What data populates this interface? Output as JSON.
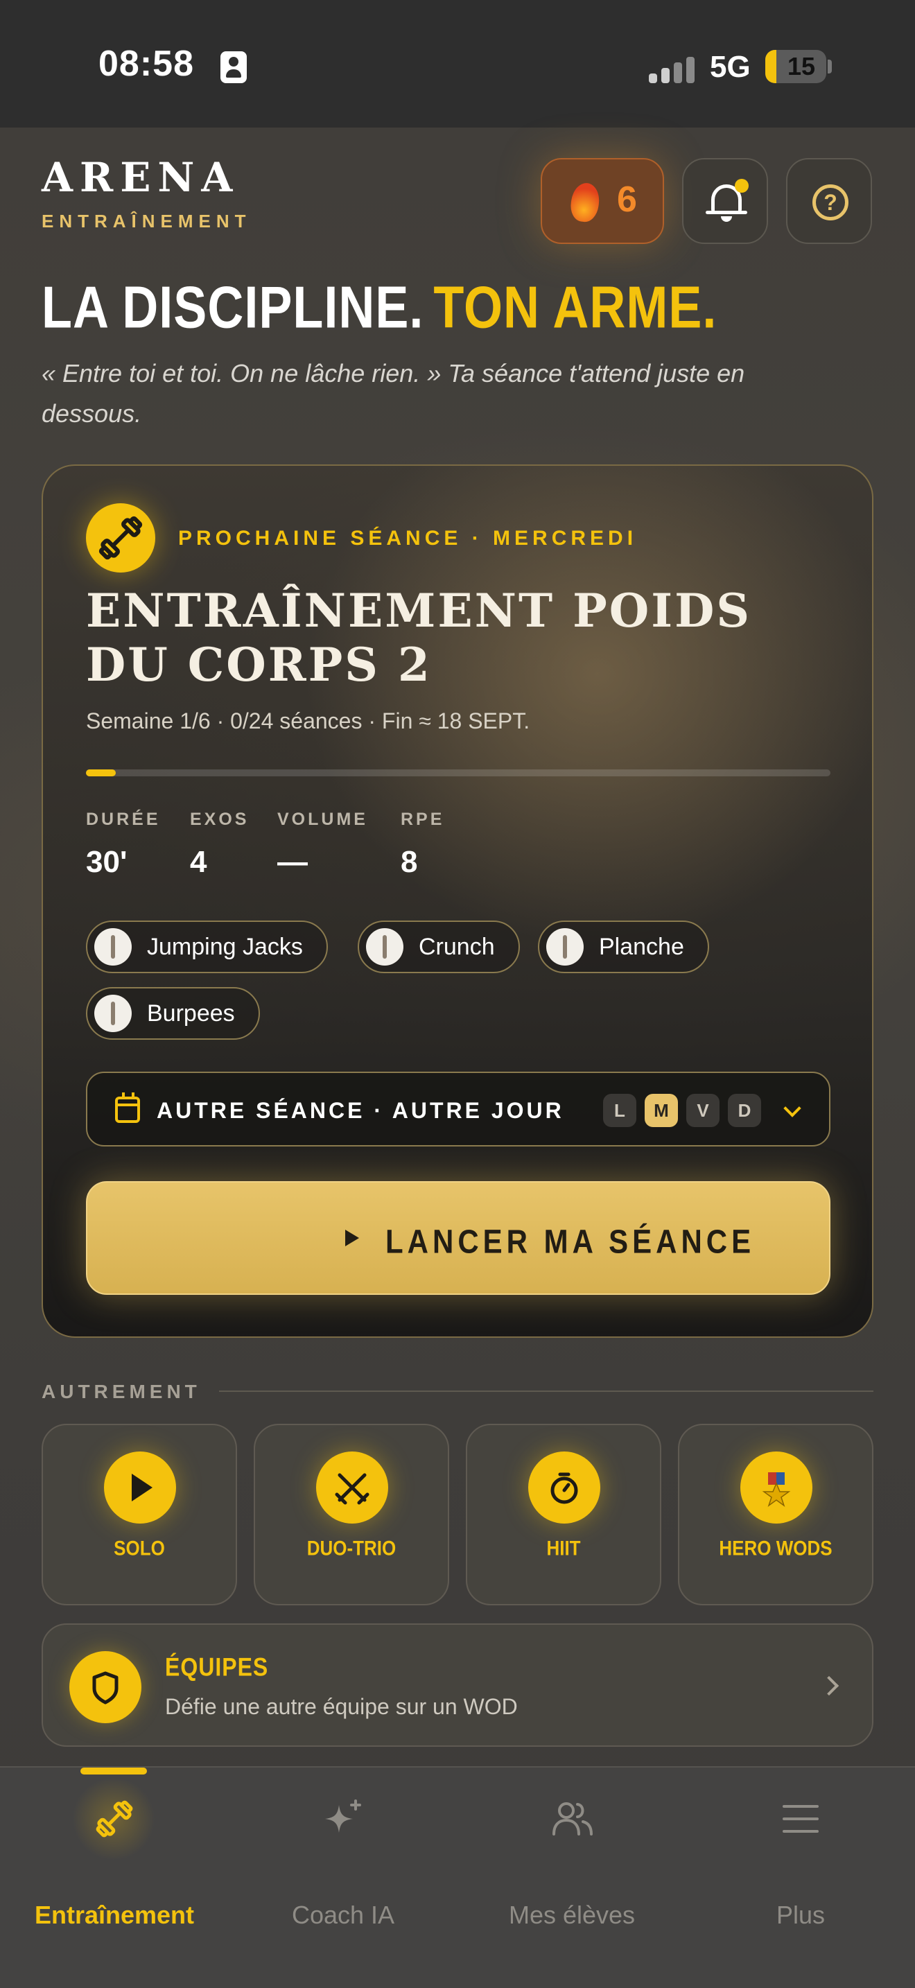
{
  "status_bar": {
    "time": "08:58",
    "network": "5G",
    "battery": "15"
  },
  "header": {
    "brand": "ARENA",
    "brand_sub": "ENTRAÎNEMENT",
    "streak": "6"
  },
  "hero": {
    "headline_part1": "LA DISCIPLINE.",
    "headline_part2": "TON ARME.",
    "quote": "« Entre toi et toi. On ne lâche rien. » Ta séance t'attend juste en dessous."
  },
  "session_card": {
    "label": "PROCHAINE SÉANCE · MERCREDI",
    "title": "ENTRAÎNEMENT POIDS DU CORPS 2",
    "meta": "Semaine 1/6 · 0/24 séances · Fin ≈ 18 SEPT.",
    "progress": 0.04,
    "stats": [
      {
        "key": "DURÉE",
        "value": "30'"
      },
      {
        "key": "EXOS",
        "value": "4"
      },
      {
        "key": "VOLUME",
        "value": "—"
      },
      {
        "key": "RPE",
        "value": "8"
      }
    ],
    "exercises": [
      "Jumping Jacks",
      "Crunch",
      "Planche",
      "Burpees"
    ],
    "alt_label": "AUTRE SÉANCE · AUTRE JOUR",
    "days": [
      "L",
      "M",
      "V",
      "D"
    ],
    "active_day": "M",
    "launch_label": "LANCER MA SÉANCE"
  },
  "autrement": {
    "title": "AUTREMENT",
    "tiles": [
      "SOLO",
      "DUO-TRIO",
      "HIIT",
      "HERO WODS"
    ]
  },
  "teams": {
    "title": "ÉQUIPES",
    "subtitle": "Défie une autre équipe sur un WOD"
  },
  "tabbar": {
    "tabs": [
      "Entraînement",
      "Coach IA",
      "Mes élèves",
      "Plus"
    ]
  },
  "colors": {
    "accent": "#f4c20d",
    "gold": "#e8c36a",
    "flame": "#f48a2a"
  }
}
